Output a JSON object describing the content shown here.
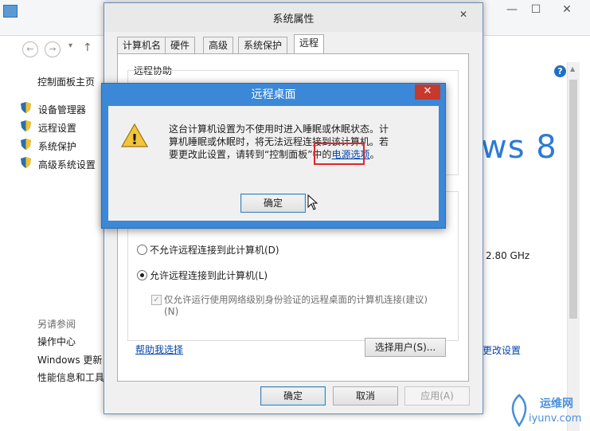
{
  "background_window": {
    "nav_back": "←",
    "nav_forward": "→",
    "nav_up": "↑",
    "minimize": "—",
    "maximize": "☐",
    "close": "✕",
    "help": "?",
    "sidebar_home": "控制面板主页",
    "sidebar_items": [
      {
        "label": "设备管理器"
      },
      {
        "label": "远程设置"
      },
      {
        "label": "系统保护"
      },
      {
        "label": "高级系统设置"
      }
    ],
    "see_also_title": "另请参阅",
    "see_also_items": [
      "操作中心",
      "Windows 更新",
      "性能信息和工具"
    ],
    "windows_logo_text": "ws 8",
    "cpu_speed": "2.80 GHz",
    "change_settings_link": "更改设置"
  },
  "system_properties": {
    "title": "系统属性",
    "close": "✕",
    "tabs": [
      "计算机名",
      "硬件",
      "高级",
      "系统保护",
      "远程"
    ],
    "active_tab": "远程",
    "remote_assistance_group": "远程协助",
    "radio_deny": "不允许远程连接到此计算机(D)",
    "radio_allow": "允许远程连接到此计算机(L)",
    "checkbox_nla": "仅允许运行使用网络级别身份验证的远程桌面的计算机连接(建议)",
    "checkbox_nla_key": "(N)",
    "help_link": "帮助我选择",
    "select_users_button": "选择用户(S)...",
    "ok_button": "确定",
    "cancel_button": "取消",
    "apply_button": "应用(A)"
  },
  "remote_desktop_dialog": {
    "title": "远程桌面",
    "close": "✕",
    "message_line1": "这台计算机设置为不使用时进入睡眠或休眠状态。计",
    "message_line2": "算机睡眠或休眠时，将无法远程连接到该计算机。若",
    "message_line3": "要更改此设置，请转到“控制面板”中的",
    "message_link": "电源选项",
    "message_end": "。",
    "ok_button": "确定",
    "warning_glyph": "!"
  },
  "watermark": {
    "text_top": "运维网",
    "text_bottom": "iyunv.com"
  },
  "colors": {
    "dialog_title_blue": "#3b88d8",
    "close_red": "#c7392b",
    "highlight_red": "#e0262d",
    "link_blue": "#0645ad",
    "windows_logo_blue": "#2b7bd6"
  }
}
